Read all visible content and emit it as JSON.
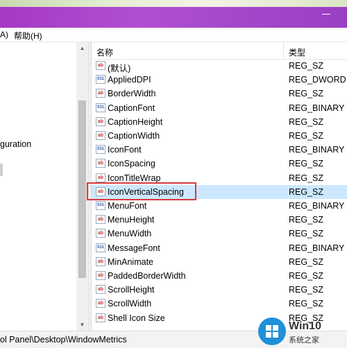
{
  "menu": {
    "partial_item": "A)",
    "help": "帮助(H)"
  },
  "tree": {
    "partial_item": "guration"
  },
  "list": {
    "column_name": "名称",
    "column_type": "类型",
    "rows": [
      {
        "name": "(默认)",
        "type": "REG_SZ",
        "icon": "string-value-icon"
      },
      {
        "name": "AppliedDPI",
        "type": "REG_DWORD",
        "icon": "binary-value-icon"
      },
      {
        "name": "BorderWidth",
        "type": "REG_SZ",
        "icon": "string-value-icon"
      },
      {
        "name": "CaptionFont",
        "type": "REG_BINARY",
        "icon": "binary-value-icon"
      },
      {
        "name": "CaptionHeight",
        "type": "REG_SZ",
        "icon": "string-value-icon"
      },
      {
        "name": "CaptionWidth",
        "type": "REG_SZ",
        "icon": "string-value-icon"
      },
      {
        "name": "IconFont",
        "type": "REG_BINARY",
        "icon": "binary-value-icon"
      },
      {
        "name": "IconSpacing",
        "type": "REG_SZ",
        "icon": "string-value-icon"
      },
      {
        "name": "IconTitleWrap",
        "type": "REG_SZ",
        "icon": "string-value-icon"
      },
      {
        "name": "IconVerticalSpacing",
        "type": "REG_SZ",
        "icon": "string-value-icon",
        "selected": true
      },
      {
        "name": "MenuFont",
        "type": "REG_BINARY",
        "icon": "binary-value-icon"
      },
      {
        "name": "MenuHeight",
        "type": "REG_SZ",
        "icon": "string-value-icon"
      },
      {
        "name": "MenuWidth",
        "type": "REG_SZ",
        "icon": "string-value-icon"
      },
      {
        "name": "MessageFont",
        "type": "REG_BINARY",
        "icon": "binary-value-icon"
      },
      {
        "name": "MinAnimate",
        "type": "REG_SZ",
        "icon": "string-value-icon"
      },
      {
        "name": "PaddedBorderWidth",
        "type": "REG_SZ",
        "icon": "string-value-icon"
      },
      {
        "name": "ScrollHeight",
        "type": "REG_SZ",
        "icon": "string-value-icon"
      },
      {
        "name": "ScrollWidth",
        "type": "REG_SZ",
        "icon": "string-value-icon"
      },
      {
        "name": "Shell Icon Size",
        "type": "REG_SZ",
        "icon": "string-value-icon"
      }
    ]
  },
  "status": {
    "path": "ol Panel\\Desktop\\WindowMetrics"
  },
  "watermark": {
    "title": "Win10",
    "subtitle": "系统之家"
  },
  "colors": {
    "titlebar": "#a638c6",
    "selection": "#cce8ff",
    "highlight_box": "#d9393b",
    "logo": "#1f90d8"
  }
}
